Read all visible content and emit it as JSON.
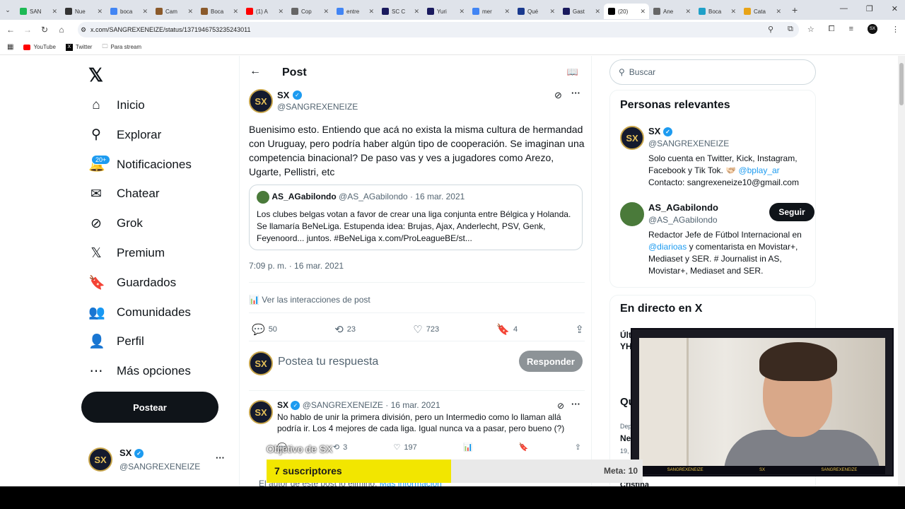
{
  "browser": {
    "tabs": [
      {
        "label": "SAN",
        "color": "#1db954"
      },
      {
        "label": "Nue",
        "color": "#333333"
      },
      {
        "label": "boca",
        "color": "#4285f4"
      },
      {
        "label": "Cam",
        "color": "#8b5a2b"
      },
      {
        "label": "Boca",
        "color": "#8b5a2b"
      },
      {
        "label": "(1) A",
        "color": "#ff0000"
      },
      {
        "label": "Cop",
        "color": "#666666"
      },
      {
        "label": "entre",
        "color": "#4285f4"
      },
      {
        "label": "SC C",
        "color": "#1a1a5e"
      },
      {
        "label": "Yuri",
        "color": "#1a1a5e"
      },
      {
        "label": "mer",
        "color": "#4285f4"
      },
      {
        "label": "Qué",
        "color": "#1a3a8e"
      },
      {
        "label": "Gast",
        "color": "#1a1a5e"
      },
      {
        "label": "(20)",
        "color": "#000000",
        "active": true
      },
      {
        "label": "Ane",
        "color": "#666666"
      },
      {
        "label": "Boca",
        "color": "#1fa0c8"
      },
      {
        "label": "Cata",
        "color": "#e8a317"
      }
    ],
    "url": "x.com/SANGREXENEIZE/status/1371946753235243011",
    "bookmarks": [
      "YouTube",
      "Twitter",
      "Para stream"
    ],
    "profile_initials": "SX"
  },
  "nav": {
    "items": [
      {
        "label": "Inicio",
        "icon": "home-icon",
        "glyph": "⌂"
      },
      {
        "label": "Explorar",
        "icon": "search-icon",
        "glyph": "⚲"
      },
      {
        "label": "Notificaciones",
        "icon": "bell-icon",
        "glyph": "🔔",
        "badge": "20+"
      },
      {
        "label": "Chatear",
        "icon": "mail-icon",
        "glyph": "✉"
      },
      {
        "label": "Grok",
        "icon": "grok-icon",
        "glyph": "⊘"
      },
      {
        "label": "Premium",
        "icon": "x-premium-icon",
        "glyph": "𝕏"
      },
      {
        "label": "Guardados",
        "icon": "bookmark-icon",
        "glyph": "🔖"
      },
      {
        "label": "Comunidades",
        "icon": "communities-icon",
        "glyph": "👥"
      },
      {
        "label": "Perfil",
        "icon": "profile-icon",
        "glyph": "👤"
      },
      {
        "label": "Más opciones",
        "icon": "more-icon",
        "glyph": "⋯"
      }
    ],
    "post_button": "Postear",
    "account": {
      "name": "SX",
      "handle": "@SANGREXENEIZE",
      "more": "···"
    }
  },
  "main": {
    "title": "Post",
    "tweet": {
      "name": "SX",
      "handle": "@SANGREXENEIZE",
      "text": "Buenisimo esto. Entiendo que acá no exista la misma cultura de hermandad con Uruguay, pero podría haber algún tipo de cooperación. Se imaginan una competencia binacional? De paso vas y ves a jugadores como Arezo, Ugarte, Pellistri, etc",
      "quote": {
        "name": "AS_AGabilondo",
        "handle": "@AS_AGabilondo · 16 mar. 2021",
        "text": "Los clubes belgas votan a favor de crear una liga conjunta entre Bélgica y Holanda. Se llamaría BeNeLiga. Estupenda idea: Brujas, Ajax, Anderlecht, PSV, Genk, Feyenoord... juntos. #BeNeLiga x.com/ProLeagueBE/st..."
      },
      "timestamp": "7:09 p. m. · 16 mar. 2021",
      "interactions_link": "Ver las interacciones de post",
      "stats": {
        "replies": "50",
        "reposts": "23",
        "likes": "723",
        "bookmarks": "4"
      }
    },
    "reply_box": {
      "placeholder": "Postea tu respuesta",
      "button": "Responder"
    },
    "reply": {
      "name": "SX",
      "handle": "@SANGREXENEIZE · 16 mar. 2021",
      "text": "No hablo de unir la primera división, pero un Intermedio como lo llaman allá podría ir. Los 4 mejores de cada liga. Igual nunca va a pasar, pero bueno (?)",
      "reposts": "3",
      "likes": "197"
    },
    "deleted_note": "El autor de este post lo eliminó.",
    "deleted_link": "Más información"
  },
  "sidebar": {
    "search_placeholder": "Buscar",
    "relevant_title": "Personas relevantes",
    "people": [
      {
        "name": "SX",
        "handle": "@SANGREXENEIZE",
        "bio": "Solo cuenta en Twitter, Kick, Instagram, Facebook y Tik Tok. 🫱🏻‍🫲🏼",
        "bio_link": "@bplay_ar",
        "bio2": "Contacto: sangrexeneize10@gmail.com"
      },
      {
        "name": "AS_AGabilondo",
        "handle": "@AS_AGabilondo",
        "bio": "Redactor Jefe de Fútbol Internacional en",
        "bio_link": "@diarioas",
        "bio2": "y comentarista en Movistar+, Mediaset y SER. # Journalist in AS, Movistar+, Mediaset and SER.",
        "follow": "Seguir"
      }
    ],
    "live_title": "En directo en X",
    "live_frag1": "Últ",
    "live_frag2": "YH",
    "trend_frag": "Qu",
    "trend_small": "Dep",
    "trend_big": "Ne",
    "trend_num": "19,",
    "trend_cris": "Cristina"
  },
  "stream_overlay": {
    "goal_title": "Objetivo de SX",
    "subs_label": "7 suscriptores",
    "subs_current": 7,
    "subs_goal": 10,
    "goal_label": "Meta: 10",
    "cam_strip": [
      "SANGREXENEIZE",
      "SX",
      "SANGREXENEIZE"
    ]
  },
  "colors": {
    "accent": "#1d9bf0",
    "progress": "#f2e600"
  }
}
